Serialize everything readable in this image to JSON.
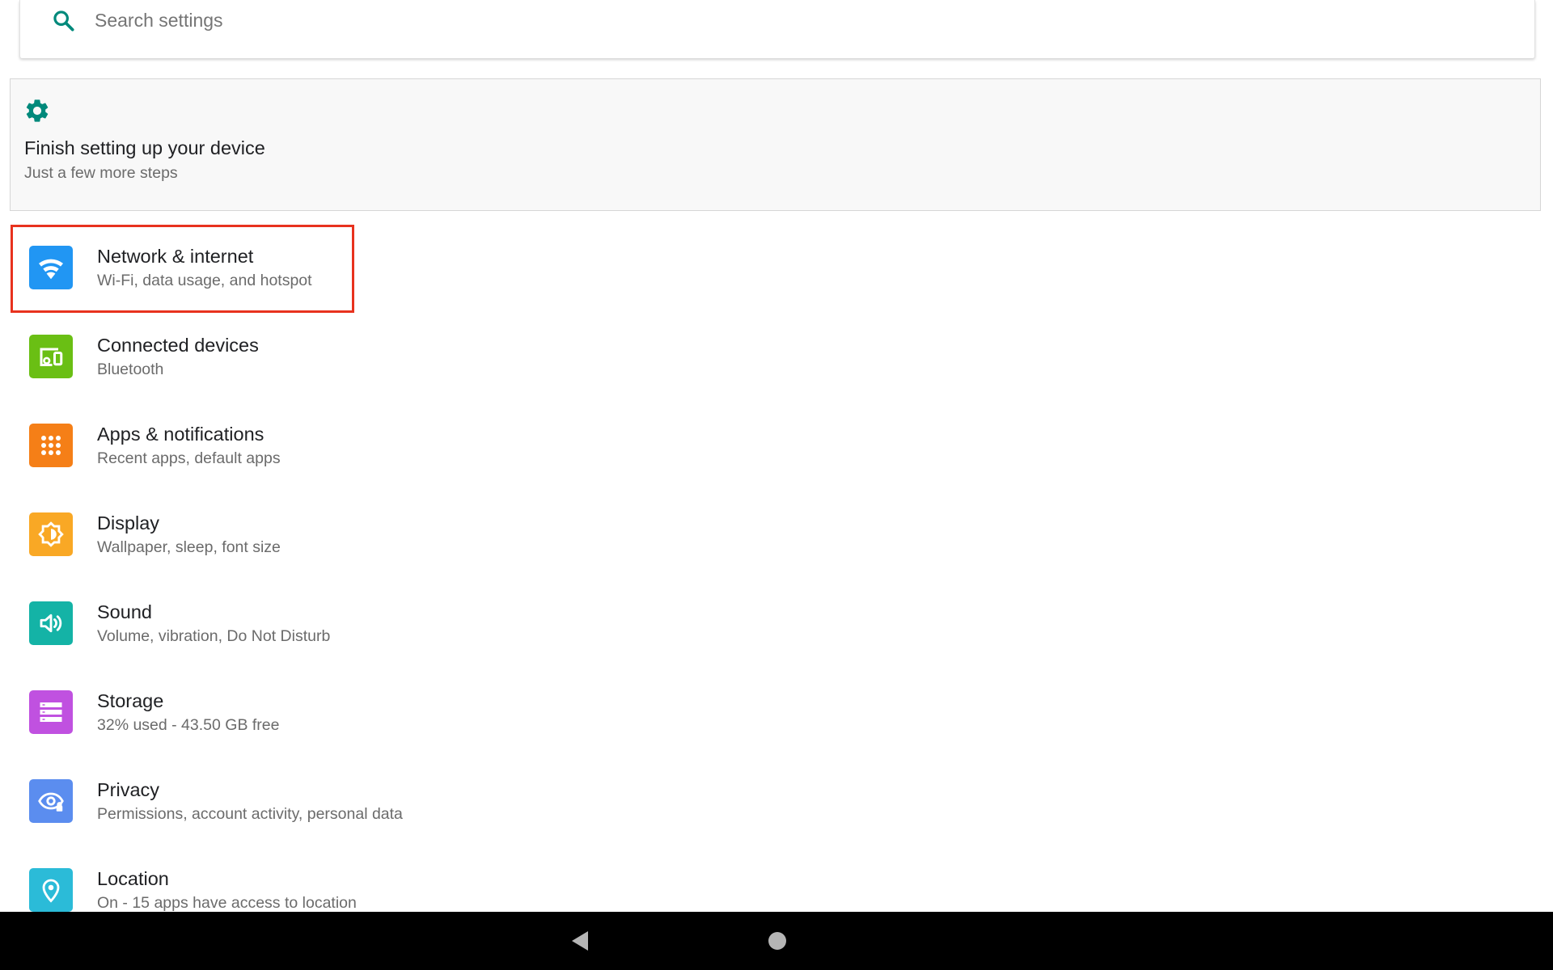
{
  "search": {
    "placeholder": "Search settings",
    "icon": "search-icon"
  },
  "suggestion": {
    "icon": "gear-icon",
    "title": "Finish setting up your device",
    "subtitle": "Just a few more steps"
  },
  "settings": {
    "items": [
      {
        "key": "network",
        "title": "Network & internet",
        "subtitle": "Wi-Fi, data usage, and hotspot",
        "icon": "wifi-icon",
        "color": "#2196f3"
      },
      {
        "key": "connected",
        "title": "Connected devices",
        "subtitle": "Bluetooth",
        "icon": "devices-icon",
        "color": "#6abf14"
      },
      {
        "key": "apps",
        "title": "Apps & notifications",
        "subtitle": "Recent apps, default apps",
        "icon": "apps-grid-icon",
        "color": "#f57f17"
      },
      {
        "key": "display",
        "title": "Display",
        "subtitle": "Wallpaper, sleep, font size",
        "icon": "brightness-icon",
        "color": "#f9a825"
      },
      {
        "key": "sound",
        "title": "Sound",
        "subtitle": "Volume, vibration, Do Not Disturb",
        "icon": "volume-icon",
        "color": "#14b3a6"
      },
      {
        "key": "storage",
        "title": "Storage",
        "subtitle": "32% used - 43.50 GB free",
        "icon": "storage-icon",
        "color": "#c051e0"
      },
      {
        "key": "privacy",
        "title": "Privacy",
        "subtitle": "Permissions, account activity, personal data",
        "icon": "privacy-eye-icon",
        "color": "#5b8def"
      },
      {
        "key": "location",
        "title": "Location",
        "subtitle": "On - 15 apps have access to location",
        "icon": "location-pin-icon",
        "color": "#2bbbd8"
      }
    ]
  },
  "highlight": {
    "target": "network",
    "color": "#e8321e"
  },
  "navbar": {
    "back_icon": "back-triangle-icon",
    "home_icon": "home-circle-icon"
  },
  "colors": {
    "accent": "#00897b"
  }
}
